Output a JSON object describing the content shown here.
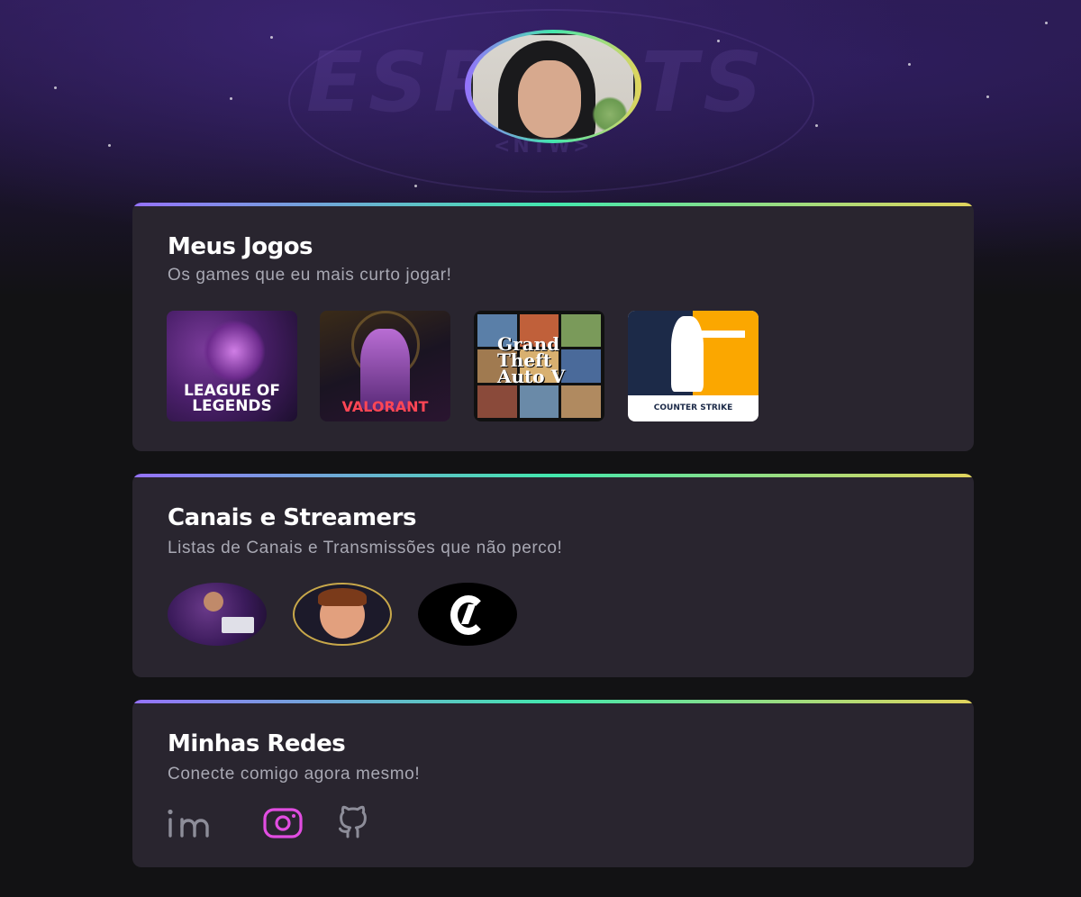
{
  "profile": {
    "avatar_alt": "Foto de perfil"
  },
  "hero": {
    "emblem_text": "ESPORTS",
    "emblem_sub": "<NTW>"
  },
  "sections": {
    "games": {
      "title": "Meus Jogos",
      "subtitle": "Os games que eu mais curto jogar!",
      "items": [
        {
          "label": "LEAGUE OF LEGENDS",
          "icon": "league-of-legends-cover"
        },
        {
          "label": "VALORANT",
          "icon": "valorant-cover"
        },
        {
          "label": "Grand Theft Auto V",
          "icon": "gta-v-cover"
        },
        {
          "label": "COUNTER STRIKE",
          "icon": "counter-strike-cover"
        }
      ]
    },
    "channels": {
      "title": "Canais e Streamers",
      "subtitle": "Listas de Canais e Transmissões que não perco!",
      "items": [
        {
          "icon": "streamer-avatar-1"
        },
        {
          "icon": "streamer-avatar-2"
        },
        {
          "icon": "streamer-avatar-3"
        }
      ]
    },
    "social": {
      "title": "Minhas Redes",
      "subtitle": "Conecte comigo agora mesmo!",
      "items": [
        {
          "icon": "linkedin-icon",
          "color": "#8d8d99"
        },
        {
          "icon": "instagram-icon",
          "color": "#e14de1"
        },
        {
          "icon": "github-icon",
          "color": "#8d8d99"
        }
      ]
    }
  },
  "colors": {
    "gradient": [
      "#9572fc",
      "#43e7ad",
      "#e2d45c"
    ],
    "card_bg": "#29252f",
    "page_bg": "#121214"
  }
}
